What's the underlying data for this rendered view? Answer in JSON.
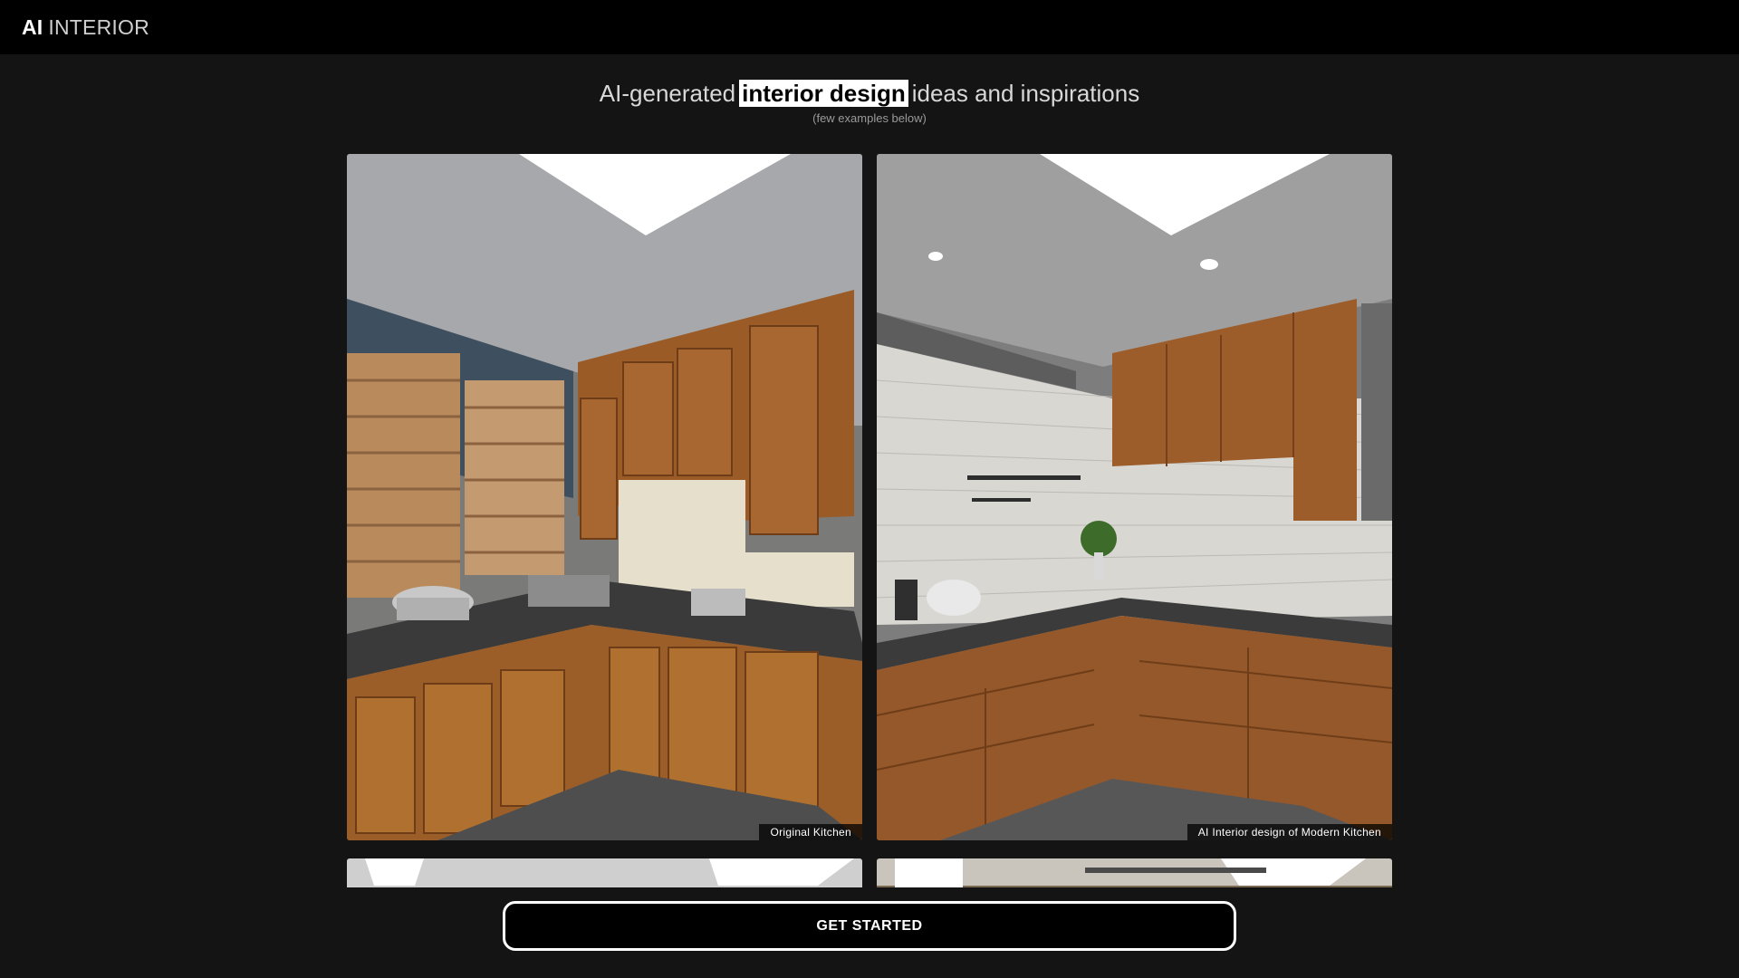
{
  "brand": {
    "bold": "AI",
    "light": "INTERIOR"
  },
  "hero": {
    "before": "AI-generated",
    "highlight": "interior design",
    "after": "ideas and inspirations",
    "sub": "(few examples below)"
  },
  "gallery": {
    "items": [
      {
        "caption": "Original Kitchen"
      },
      {
        "caption": "AI Interior design of Modern Kitchen"
      }
    ]
  },
  "cta": {
    "label": "GET STARTED"
  }
}
